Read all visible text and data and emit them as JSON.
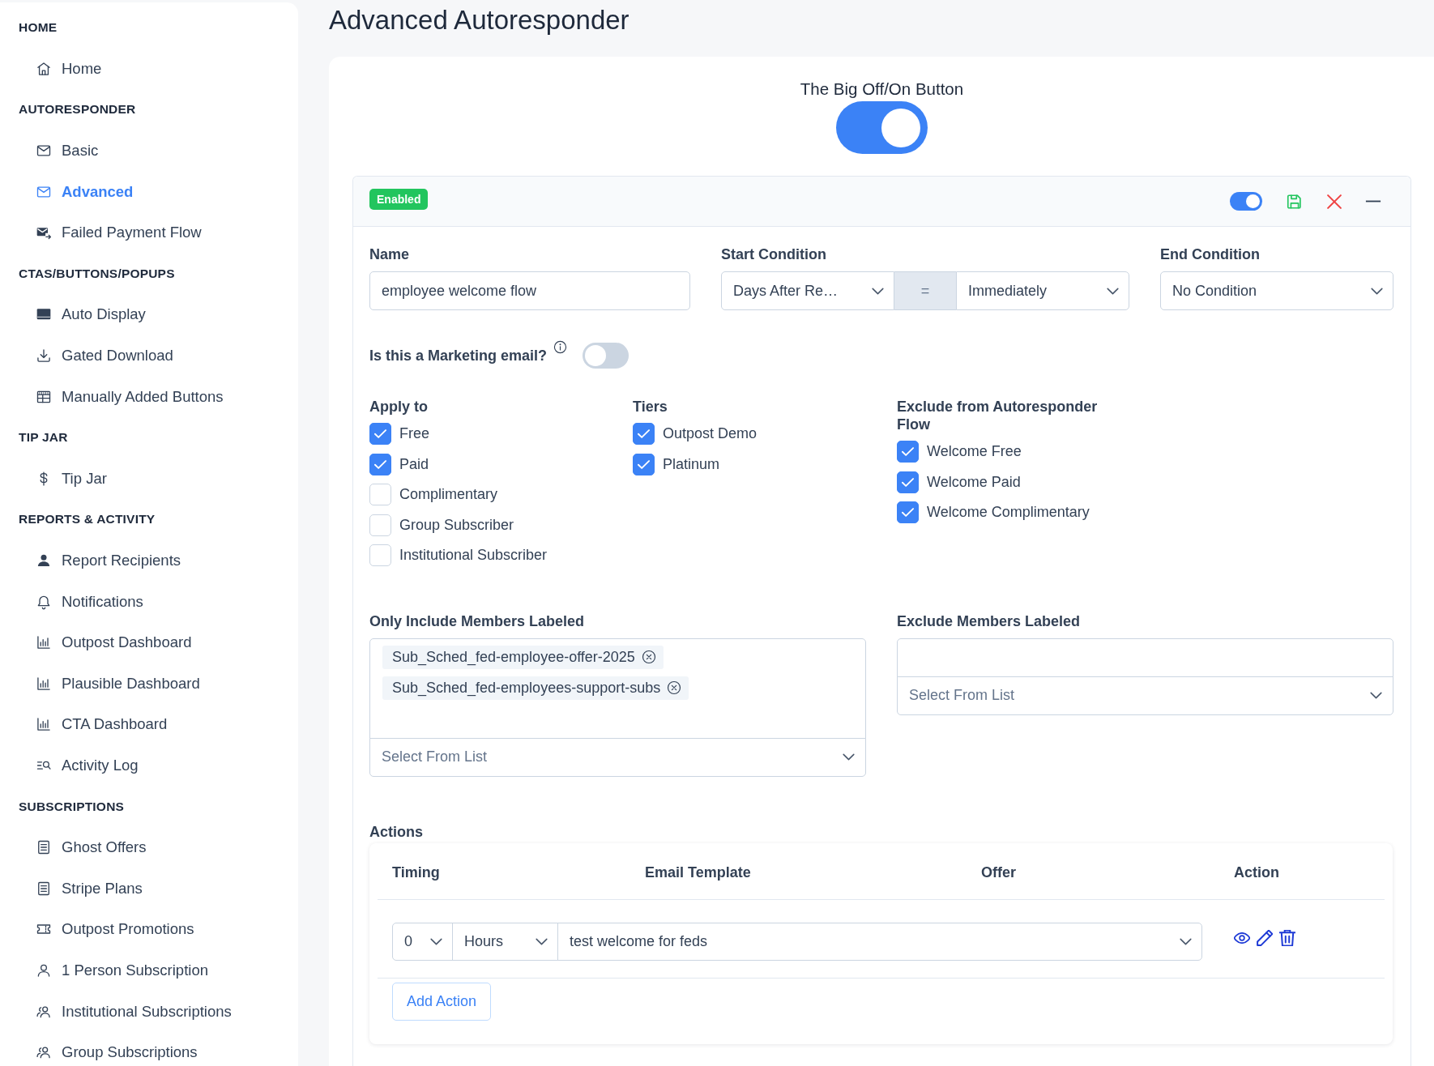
{
  "sidebar": {
    "sections": [
      {
        "heading": "HOME",
        "items": [
          {
            "label": "Home",
            "selected": false
          }
        ]
      },
      {
        "heading": "AUTORESPONDER",
        "items": [
          {
            "label": "Basic",
            "selected": false
          },
          {
            "label": "Advanced",
            "selected": true
          },
          {
            "label": "Failed Payment Flow",
            "selected": false
          }
        ]
      },
      {
        "heading": "CTAS/BUTTONS/POPUPS",
        "items": [
          {
            "label": "Auto Display",
            "selected": false
          },
          {
            "label": "Gated Download",
            "selected": false
          },
          {
            "label": "Manually Added Buttons",
            "selected": false
          }
        ]
      },
      {
        "heading": "TIP JAR",
        "items": [
          {
            "label": "Tip Jar",
            "selected": false
          }
        ]
      },
      {
        "heading": "REPORTS & ACTIVITY",
        "items": [
          {
            "label": "Report Recipients",
            "selected": false
          },
          {
            "label": "Notifications",
            "selected": false
          },
          {
            "label": "Outpost Dashboard",
            "selected": false
          },
          {
            "label": "Plausible Dashboard",
            "selected": false
          },
          {
            "label": "CTA Dashboard",
            "selected": false
          },
          {
            "label": "Activity Log",
            "selected": false
          }
        ]
      },
      {
        "heading": "SUBSCRIPTIONS",
        "items": [
          {
            "label": "Ghost Offers",
            "selected": false
          },
          {
            "label": "Stripe Plans",
            "selected": false
          },
          {
            "label": "Outpost Promotions",
            "selected": false
          },
          {
            "label": "1 Person Subscription",
            "selected": false
          },
          {
            "label": "Institutional Subscriptions",
            "selected": false
          },
          {
            "label": "Group Subscriptions",
            "selected": false
          }
        ]
      }
    ]
  },
  "page_title": "Advanced Autoresponder",
  "master_switch": {
    "label": "The Big Off/On Button",
    "on": true
  },
  "autoresponder": {
    "status": "Enabled",
    "on": true,
    "name": {
      "label": "Name",
      "value": "employee welcome flow"
    },
    "start_condition": {
      "label": "Start Condition",
      "trigger": "Days After Re…",
      "operator": "=",
      "timing": "Immediately"
    },
    "end_condition": {
      "label": "End Condition",
      "value": "No Condition"
    },
    "marketing_email": {
      "label": "Is this a Marketing email?",
      "on": false
    },
    "checkbox_groups": [
      {
        "heading": "Apply to",
        "options": [
          {
            "label": "Free",
            "checked": true
          },
          {
            "label": "Paid",
            "checked": true
          },
          {
            "label": "Complimentary",
            "checked": false
          },
          {
            "label": "Group Subscriber",
            "checked": false
          },
          {
            "label": "Institutional Subscriber",
            "checked": false
          }
        ]
      },
      {
        "heading": "Tiers",
        "options": [
          {
            "label": "Outpost Demo",
            "checked": true
          },
          {
            "label": "Platinum",
            "checked": true
          }
        ]
      },
      {
        "heading": "Exclude from Autoresponder Flow",
        "options": [
          {
            "label": "Welcome Free",
            "checked": true
          },
          {
            "label": "Welcome Paid",
            "checked": true
          },
          {
            "label": "Welcome Complimentary",
            "checked": true
          }
        ]
      }
    ],
    "only_include": {
      "label": "Only Include Members Labeled",
      "tags": [
        {
          "label": "Sub_Sched_fed-employee-offer-2025"
        },
        {
          "label": "Sub_Sched_fed-employees-support-subs"
        }
      ],
      "placeholder": "Select From List"
    },
    "exclude_members": {
      "label": "Exclude Members Labeled",
      "placeholder": "Select From List"
    },
    "actions": {
      "title": "Actions",
      "columns": [
        "Timing",
        "Email Template",
        "Offer",
        "Action"
      ],
      "rows": [
        {
          "amount": "0",
          "unit": "Hours",
          "template": "test welcome for feds"
        }
      ],
      "add_button": "Add Action"
    }
  }
}
